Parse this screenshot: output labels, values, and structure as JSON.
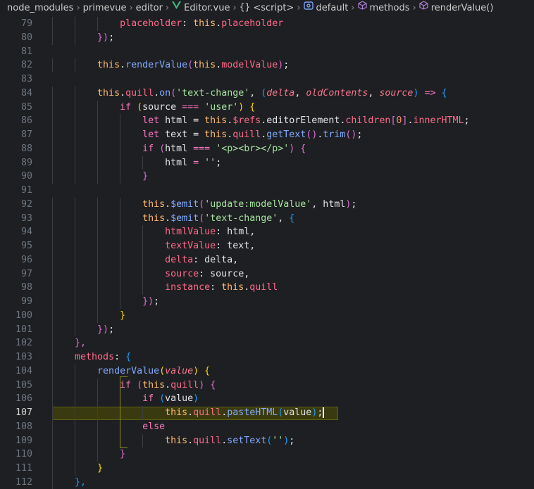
{
  "breadcrumb": {
    "items": [
      {
        "label": "node_modules",
        "icon": ""
      },
      {
        "label": "primevue",
        "icon": ""
      },
      {
        "label": "editor",
        "icon": ""
      },
      {
        "label": "Editor.vue",
        "icon": "vue-icon"
      },
      {
        "label": "<script>",
        "icon": "braces-icon"
      },
      {
        "label": "default",
        "icon": "symbol-module-icon"
      },
      {
        "label": "methods",
        "icon": "cube-icon"
      },
      {
        "label": "renderValue()",
        "icon": "cube-icon"
      }
    ]
  },
  "editor": {
    "active_line": "107",
    "lines": [
      {
        "n": "79"
      },
      {
        "n": "80"
      },
      {
        "n": "81"
      },
      {
        "n": "82"
      },
      {
        "n": "83"
      },
      {
        "n": "84"
      },
      {
        "n": "85"
      },
      {
        "n": "86"
      },
      {
        "n": "87"
      },
      {
        "n": "88"
      },
      {
        "n": "89"
      },
      {
        "n": "90"
      },
      {
        "n": "91"
      },
      {
        "n": "92"
      },
      {
        "n": "93"
      },
      {
        "n": "94"
      },
      {
        "n": "95"
      },
      {
        "n": "96"
      },
      {
        "n": "97"
      },
      {
        "n": "98"
      },
      {
        "n": "99"
      },
      {
        "n": "100"
      },
      {
        "n": "101"
      },
      {
        "n": "102"
      },
      {
        "n": "103"
      },
      {
        "n": "104"
      },
      {
        "n": "105"
      },
      {
        "n": "106"
      },
      {
        "n": "107"
      },
      {
        "n": "108"
      },
      {
        "n": "109"
      },
      {
        "n": "110"
      },
      {
        "n": "111"
      },
      {
        "n": "112"
      }
    ],
    "code": [
      [
        [
          "            ",
          "pn"
        ],
        [
          "placeholder",
          "prop"
        ],
        [
          ": ",
          "pn"
        ],
        [
          "this",
          "ths"
        ],
        [
          ".",
          "pn"
        ],
        [
          "placeholder",
          "prop"
        ]
      ],
      [
        [
          "        ",
          "pn"
        ],
        [
          "})",
          "br2"
        ],
        [
          ";",
          "pn"
        ]
      ],
      [
        [
          "",
          "pn"
        ]
      ],
      [
        [
          "        ",
          "pn"
        ],
        [
          "this",
          "ths"
        ],
        [
          ".",
          "pn"
        ],
        [
          "renderValue",
          "fn"
        ],
        [
          "(",
          "br2"
        ],
        [
          "this",
          "ths"
        ],
        [
          ".",
          "pn"
        ],
        [
          "modelValue",
          "prop"
        ],
        [
          ")",
          "br2"
        ],
        [
          ";",
          "pn"
        ]
      ],
      [
        [
          "",
          "pn"
        ]
      ],
      [
        [
          "        ",
          "pn"
        ],
        [
          "this",
          "ths"
        ],
        [
          ".",
          "pn"
        ],
        [
          "quill",
          "prop"
        ],
        [
          ".",
          "pn"
        ],
        [
          "on",
          "fn"
        ],
        [
          "(",
          "br2"
        ],
        [
          "'text-change'",
          "str"
        ],
        [
          ", ",
          "pn"
        ],
        [
          "(",
          "br3"
        ],
        [
          "delta",
          "par"
        ],
        [
          ", ",
          "pn"
        ],
        [
          "oldContents",
          "par"
        ],
        [
          ", ",
          "pn"
        ],
        [
          "source",
          "par"
        ],
        [
          ")",
          "br3"
        ],
        [
          " => ",
          "kw"
        ],
        [
          "{",
          "br3"
        ]
      ],
      [
        [
          "            ",
          "pn"
        ],
        [
          "if",
          "ctl"
        ],
        [
          " (",
          "br1"
        ],
        [
          "source",
          "var"
        ],
        [
          " === ",
          "kw"
        ],
        [
          "'user'",
          "str"
        ],
        [
          ") ",
          "br1"
        ],
        [
          "{",
          "br1"
        ]
      ],
      [
        [
          "                ",
          "pn"
        ],
        [
          "let",
          "kw"
        ],
        [
          " html = ",
          "pn"
        ],
        [
          "this",
          "ths"
        ],
        [
          ".",
          "pn"
        ],
        [
          "$refs",
          "prop"
        ],
        [
          ".",
          "pn"
        ],
        [
          "editorElement",
          "var"
        ],
        [
          ".",
          "pn"
        ],
        [
          "children",
          "prop"
        ],
        [
          "[",
          "br2"
        ],
        [
          "0",
          "num"
        ],
        [
          "]",
          "br2"
        ],
        [
          ".",
          "pn"
        ],
        [
          "innerHTML",
          "prop"
        ],
        [
          ";",
          "pn"
        ]
      ],
      [
        [
          "                ",
          "pn"
        ],
        [
          "let",
          "kw"
        ],
        [
          " text = ",
          "pn"
        ],
        [
          "this",
          "ths"
        ],
        [
          ".",
          "pn"
        ],
        [
          "quill",
          "prop"
        ],
        [
          ".",
          "pn"
        ],
        [
          "getText",
          "fn"
        ],
        [
          "()",
          "br2"
        ],
        [
          ".",
          "pn"
        ],
        [
          "trim",
          "fn"
        ],
        [
          "()",
          "br2"
        ],
        [
          ";",
          "pn"
        ]
      ],
      [
        [
          "                ",
          "pn"
        ],
        [
          "if",
          "ctl"
        ],
        [
          " (",
          "br2"
        ],
        [
          "html",
          "var"
        ],
        [
          " === ",
          "kw"
        ],
        [
          "'<p><br></p>'",
          "str"
        ],
        [
          ") ",
          "br2"
        ],
        [
          "{",
          "br2"
        ]
      ],
      [
        [
          "                    ",
          "pn"
        ],
        [
          "html",
          "var"
        ],
        [
          " = ",
          "kw"
        ],
        [
          "''",
          "str"
        ],
        [
          ";",
          "pn"
        ]
      ],
      [
        [
          "                ",
          "pn"
        ],
        [
          "}",
          "br2"
        ]
      ],
      [
        [
          "",
          "pn"
        ]
      ],
      [
        [
          "                ",
          "pn"
        ],
        [
          "this",
          "ths"
        ],
        [
          ".",
          "pn"
        ],
        [
          "$emit",
          "fn"
        ],
        [
          "(",
          "br2"
        ],
        [
          "'update:modelValue'",
          "str"
        ],
        [
          ", html",
          "pn"
        ],
        [
          ")",
          "br2"
        ],
        [
          ";",
          "pn"
        ]
      ],
      [
        [
          "                ",
          "pn"
        ],
        [
          "this",
          "ths"
        ],
        [
          ".",
          "pn"
        ],
        [
          "$emit",
          "fn"
        ],
        [
          "(",
          "br2"
        ],
        [
          "'text-change'",
          "str"
        ],
        [
          ", ",
          "pn"
        ],
        [
          "{",
          "br3"
        ]
      ],
      [
        [
          "                    ",
          "pn"
        ],
        [
          "htmlValue",
          "prop"
        ],
        [
          ": html,",
          "pn"
        ]
      ],
      [
        [
          "                    ",
          "pn"
        ],
        [
          "textValue",
          "prop"
        ],
        [
          ": text,",
          "pn"
        ]
      ],
      [
        [
          "                    ",
          "pn"
        ],
        [
          "delta",
          "prop"
        ],
        [
          ": delta,",
          "pn"
        ]
      ],
      [
        [
          "                    ",
          "pn"
        ],
        [
          "source",
          "prop"
        ],
        [
          ": source,",
          "pn"
        ]
      ],
      [
        [
          "                    ",
          "pn"
        ],
        [
          "instance",
          "prop"
        ],
        [
          ": ",
          "pn"
        ],
        [
          "this",
          "ths"
        ],
        [
          ".",
          "pn"
        ],
        [
          "quill",
          "prop"
        ]
      ],
      [
        [
          "                ",
          "pn"
        ],
        [
          "})",
          "br2"
        ],
        [
          ";",
          "pn"
        ]
      ],
      [
        [
          "            ",
          "pn"
        ],
        [
          "}",
          "br1"
        ]
      ],
      [
        [
          "        ",
          "pn"
        ],
        [
          "})",
          "br2"
        ],
        [
          ";",
          "pn"
        ]
      ],
      [
        [
          "    ",
          "pn"
        ],
        [
          "},",
          "br2"
        ]
      ],
      [
        [
          "    ",
          "pn"
        ],
        [
          "methods",
          "prop"
        ],
        [
          ": ",
          "pn"
        ],
        [
          "{",
          "br3"
        ]
      ],
      [
        [
          "        ",
          "pn"
        ],
        [
          "renderValue",
          "fn"
        ],
        [
          "(",
          "br1"
        ],
        [
          "value",
          "par"
        ],
        [
          ") ",
          "br1"
        ],
        [
          "{",
          "br1"
        ]
      ],
      [
        [
          "            ",
          "pn"
        ],
        [
          "if",
          "ctl"
        ],
        [
          " (",
          "br2"
        ],
        [
          "this",
          "ths"
        ],
        [
          ".",
          "pn"
        ],
        [
          "quill",
          "prop"
        ],
        [
          ") ",
          "br2"
        ],
        [
          "{",
          "br2"
        ]
      ],
      [
        [
          "                ",
          "pn"
        ],
        [
          "if",
          "ctl"
        ],
        [
          " (",
          "br3"
        ],
        [
          "value",
          "var"
        ],
        [
          ")",
          "br3"
        ]
      ],
      [
        [
          "                    ",
          "pn"
        ],
        [
          "this",
          "ths"
        ],
        [
          ".",
          "pn"
        ],
        [
          "quill",
          "prop"
        ],
        [
          ".",
          "pn"
        ],
        [
          "pasteHTML",
          "fn"
        ],
        [
          "(",
          "br3"
        ],
        [
          "value",
          "var"
        ],
        [
          ")",
          "br3"
        ],
        [
          ";",
          "pn"
        ]
      ],
      [
        [
          "                ",
          "pn"
        ],
        [
          "else",
          "ctl"
        ]
      ],
      [
        [
          "                    ",
          "pn"
        ],
        [
          "this",
          "ths"
        ],
        [
          ".",
          "pn"
        ],
        [
          "quill",
          "prop"
        ],
        [
          ".",
          "pn"
        ],
        [
          "setText",
          "fn"
        ],
        [
          "(",
          "br3"
        ],
        [
          "''",
          "str"
        ],
        [
          ")",
          "br3"
        ],
        [
          ";",
          "pn"
        ]
      ],
      [
        [
          "            ",
          "pn"
        ],
        [
          "}",
          "br2"
        ]
      ],
      [
        [
          "        ",
          "pn"
        ],
        [
          "}",
          "br1"
        ]
      ],
      [
        [
          "    ",
          "pn"
        ],
        [
          "},",
          "br3"
        ]
      ]
    ]
  }
}
